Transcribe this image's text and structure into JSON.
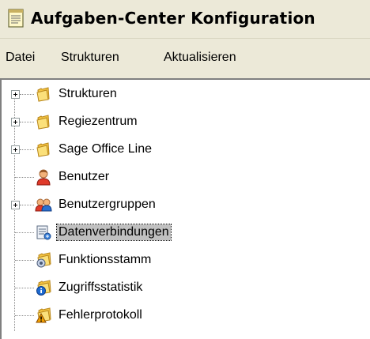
{
  "window": {
    "title": "Aufgaben-Center Konfiguration",
    "title_icon": "notepad-icon"
  },
  "menu": {
    "items": [
      {
        "label": "Datei"
      },
      {
        "label": "Strukturen"
      },
      {
        "label": "Aktualisieren"
      }
    ]
  },
  "tree": {
    "items": [
      {
        "label": "Strukturen",
        "icon": "folder-icon",
        "expandable": true,
        "selected": false
      },
      {
        "label": "Regiezentrum",
        "icon": "folder-icon",
        "expandable": true,
        "selected": false
      },
      {
        "label": "Sage Office Line",
        "icon": "folder-icon",
        "expandable": true,
        "selected": false
      },
      {
        "label": "Benutzer",
        "icon": "user-icon",
        "expandable": false,
        "selected": false
      },
      {
        "label": "Benutzergruppen",
        "icon": "user-group-icon",
        "expandable": true,
        "selected": false
      },
      {
        "label": "Datenverbindungen",
        "icon": "data-connection-icon",
        "expandable": false,
        "selected": true
      },
      {
        "label": "Funktionsstamm",
        "icon": "function-folder-icon",
        "expandable": false,
        "selected": false
      },
      {
        "label": "Zugriffsstatistik",
        "icon": "info-folder-icon",
        "expandable": false,
        "selected": false
      },
      {
        "label": "Fehlerprotokoll",
        "icon": "warning-folder-icon",
        "expandable": false,
        "selected": false
      }
    ]
  },
  "colors": {
    "chrome": "#ece9d8",
    "selection": "#c0c0c0",
    "folder": "#f5c542"
  }
}
